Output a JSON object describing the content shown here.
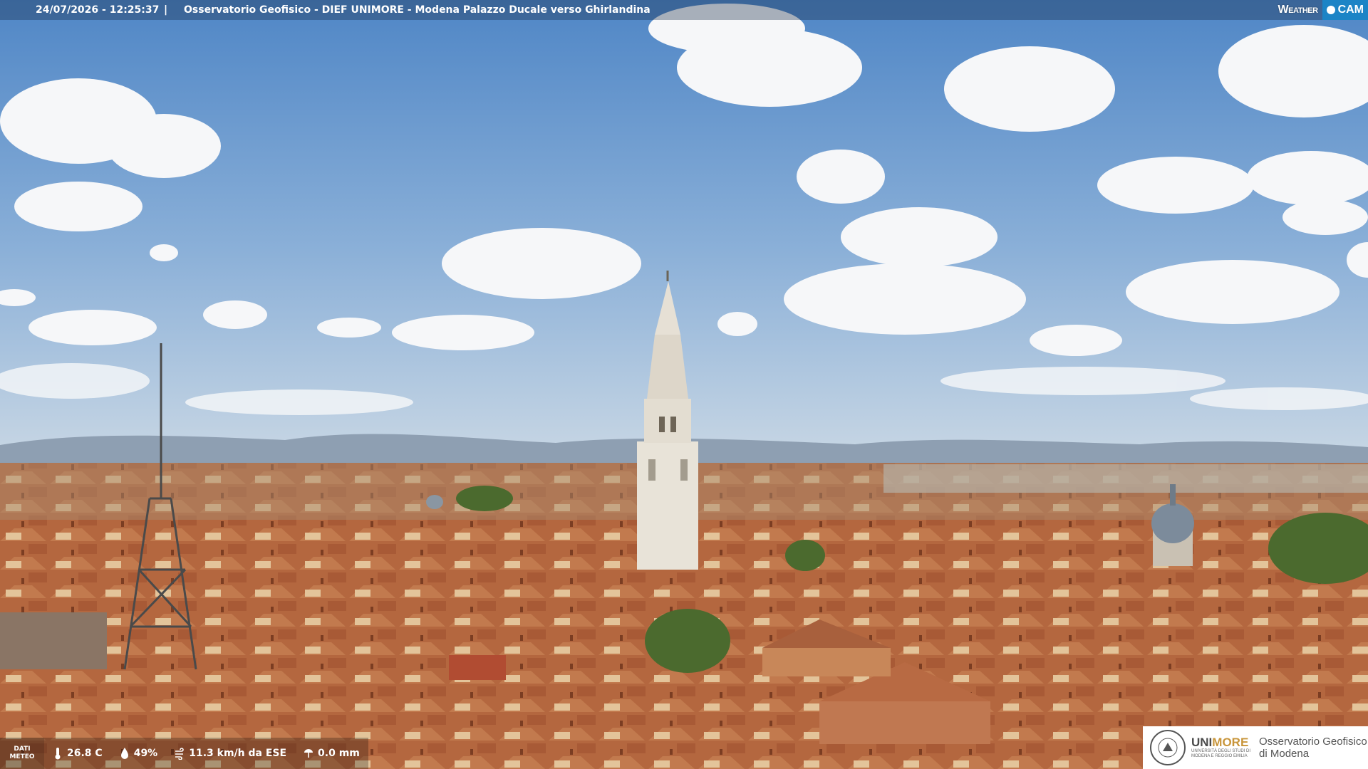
{
  "header": {
    "timestamp": "24/07/2026 - 12:25:37",
    "separator": "|",
    "location": "Osservatorio Geofisico - DIEF UNIMORE - Modena Palazzo Ducale verso Ghirlandina"
  },
  "brand": {
    "weather": "Weather",
    "cam": "CAM",
    "accent": "#1c84c6"
  },
  "meteo": {
    "label_line1": "DATI",
    "label_line2": "METEO",
    "temperature": "26.8 C",
    "humidity": "49%",
    "wind": "11.3 km/h da ESE",
    "rain": "0.0 mm",
    "icons": [
      "thermometer-icon",
      "humidity-drop-icon",
      "wind-icon",
      "rain-gauge-icon"
    ]
  },
  "logo": {
    "uni_prefix": "UNI",
    "uni_suffix": "MORE",
    "uni_sub_line1": "UNIVERSITÀ DEGLI STUDI DI",
    "uni_sub_line2": "MODENA E REGGIO EMILIA",
    "obs_line1": "Osservatorio Geofisico",
    "obs_line2": "di Modena"
  },
  "colors": {
    "sky_top": "#4f86c6",
    "sky_bottom": "#b9cfe3",
    "roofs": "#b86a43"
  }
}
